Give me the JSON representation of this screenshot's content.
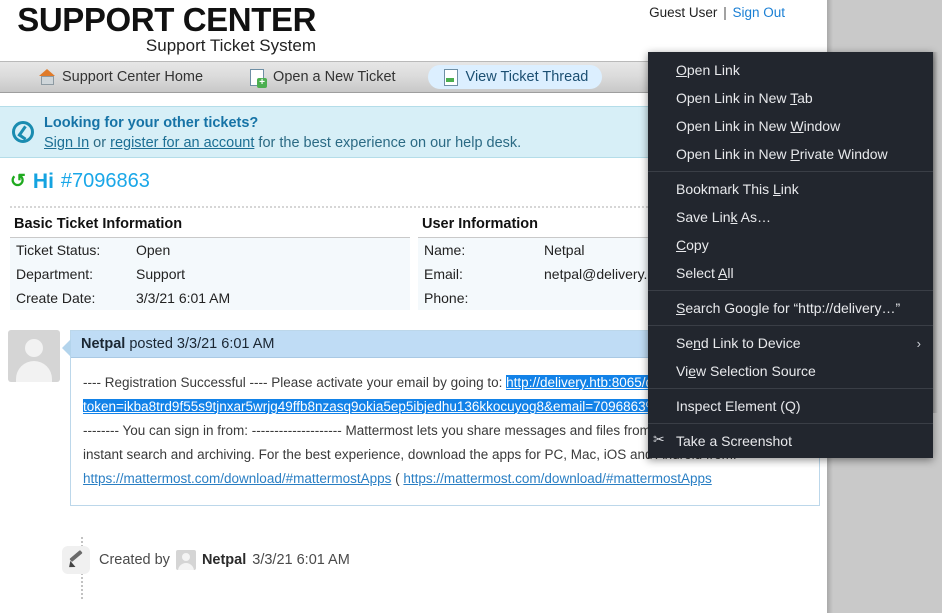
{
  "header": {
    "logo_main": "SUPPORT CENTER",
    "logo_sub": "Support Ticket System",
    "guest_label": "Guest User",
    "guest_separator": "|",
    "sign_out": "Sign Out"
  },
  "tabs": [
    {
      "label": "Support Center Home",
      "icon": "home-icon",
      "active": false
    },
    {
      "label": "Open a New Ticket",
      "icon": "new-document-icon",
      "active": false
    },
    {
      "label": "View Ticket Thread",
      "icon": "document-icon",
      "active": true
    }
  ],
  "banner": {
    "icon": "info-badge-icon",
    "title": "Looking for your other tickets?",
    "link_signin": "Sign In",
    "text_or": " or ",
    "link_register": "register for an account",
    "text_tail": " for the best experience on our help desk."
  },
  "ticket": {
    "refresh_icon": "refresh-icon",
    "subject": "Hi",
    "number": "#7096863"
  },
  "basic_info": {
    "heading": "Basic Ticket Information",
    "rows": [
      {
        "key": "Ticket Status:",
        "value": "Open"
      },
      {
        "key": "Department:",
        "value": "Support"
      },
      {
        "key": "Create Date:",
        "value": "3/3/21 6:01 AM"
      }
    ]
  },
  "user_info": {
    "heading": "User Information",
    "rows": [
      {
        "key": "Name:",
        "value": "Netpal"
      },
      {
        "key": "Email:",
        "value": "netpal@delivery.htb"
      },
      {
        "key": "Phone:",
        "value": ""
      }
    ]
  },
  "post": {
    "author": "Netpal",
    "posted_label": " posted ",
    "timestamp": "3/3/21 6:01 AM",
    "body_pre": "---- Registration Successful ---- Please activate your email by going to: ",
    "selected_url": "http://delivery.htb:8065/do_verify_email?token=ikba8trd9f55s9tjnxar5wrjg49ffb8nzasq9okia5ep5ibjedhu136kkocuyog8&email=7096863%40delivery.htb",
    "body_mid": " ) -------------------- You can sign in from: -------------------- Mattermost lets you share messages and files from your PC or phone, with instant search and archiving. For the best experience, download the apps for PC, Mac, iOS and Android from: ",
    "link1": "https://mattermost.com/download/#mattermostApps",
    "body_after_link1": " ( ",
    "link2": "https://mattermost.com/download/#mattermostApps"
  },
  "created_by": {
    "icon": "pencil-icon",
    "label": "Created by",
    "avatar": "avatar-icon",
    "author": "Netpal",
    "timestamp": "3/3/21 6:01 AM"
  },
  "context_menu": {
    "items": [
      {
        "label": "Open Link",
        "accel": "O",
        "type": "item"
      },
      {
        "label": "Open Link in New Tab",
        "accel": "T",
        "type": "item"
      },
      {
        "label": "Open Link in New Window",
        "accel": "W",
        "type": "item"
      },
      {
        "label": "Open Link in New Private Window",
        "accel": "P",
        "type": "item"
      },
      {
        "type": "separator"
      },
      {
        "label": "Bookmark This Link",
        "accel": "L",
        "type": "item"
      },
      {
        "label": "Save Link As…",
        "accel": "k",
        "type": "item"
      },
      {
        "label": "Copy",
        "accel": "C",
        "type": "item"
      },
      {
        "label": "Select All",
        "accel": "A",
        "type": "item"
      },
      {
        "type": "separator"
      },
      {
        "label": "Search Google for “http://delivery…”",
        "accel": "S",
        "type": "item"
      },
      {
        "type": "separator"
      },
      {
        "label": "Send Link to Device",
        "accel": "n",
        "type": "submenu",
        "arrow": "›"
      },
      {
        "label": "View Selection Source",
        "accel": "e",
        "type": "item"
      },
      {
        "type": "separator"
      },
      {
        "label": "Inspect Element (Q)",
        "accel": "",
        "type": "item"
      },
      {
        "type": "separator"
      },
      {
        "label": "Take a Screenshot",
        "accel": "",
        "type": "item",
        "icon": "screenshot-scissors-icon"
      }
    ]
  },
  "colors": {
    "brand_blue": "#14a3e0",
    "link_blue": "#2a7fc4",
    "selection_blue": "#1282e8",
    "banner_bg": "#d7eff7",
    "menu_bg": "#22262e",
    "desktop_gray": "#c9c9c9"
  }
}
